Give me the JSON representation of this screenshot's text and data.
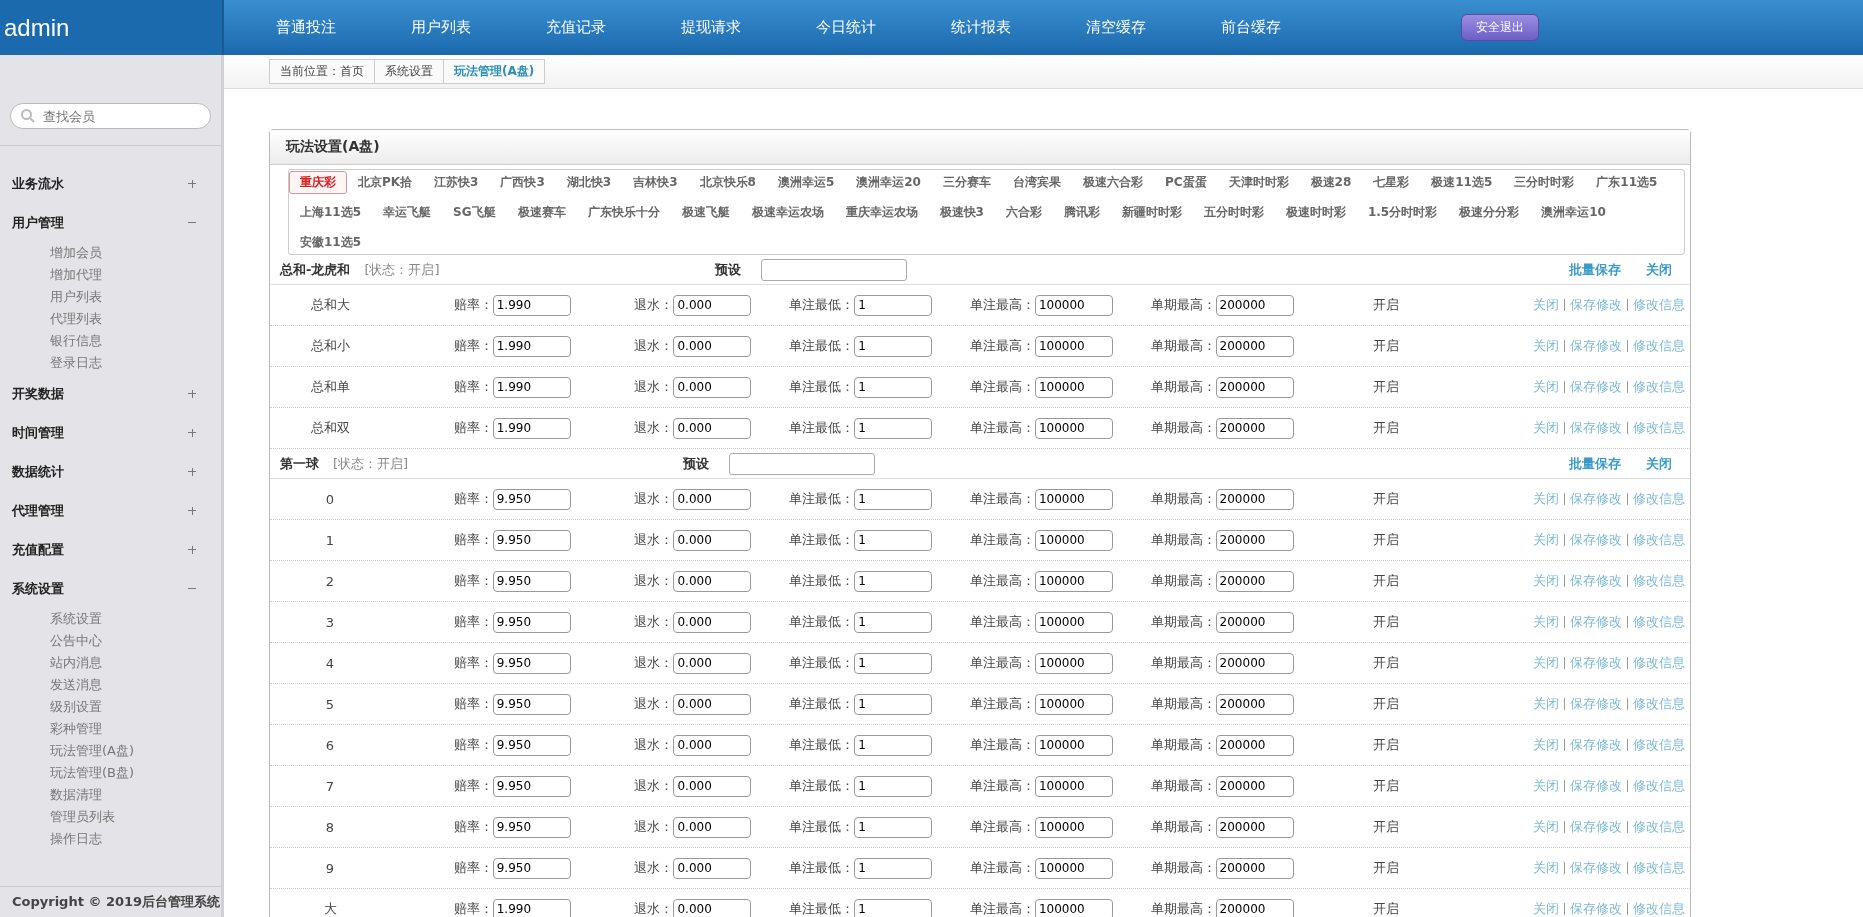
{
  "header": {
    "brand": "admin",
    "nav": [
      "普通投注",
      "用户列表",
      "充值记录",
      "提现请求",
      "今日统计",
      "统计报表",
      "清空缓存",
      "前台缓存"
    ],
    "logout": "安全退出"
  },
  "breadcrumb": [
    "当前位置：首页",
    "系统设置",
    "玩法管理(A盘)"
  ],
  "sidebar": {
    "search_placeholder": "查找会员",
    "menu": [
      {
        "label": "业务流水",
        "expanded": false
      },
      {
        "label": "用户管理",
        "expanded": true,
        "children": [
          "增加会员",
          "增加代理",
          "用户列表",
          "代理列表",
          "银行信息",
          "登录日志"
        ]
      },
      {
        "label": "开奖数据",
        "expanded": false
      },
      {
        "label": "时间管理",
        "expanded": false
      },
      {
        "label": "数据统计",
        "expanded": false
      },
      {
        "label": "代理管理",
        "expanded": false
      },
      {
        "label": "充值配置",
        "expanded": false
      },
      {
        "label": "系统设置",
        "expanded": true,
        "children": [
          "系统设置",
          "公告中心",
          "站内消息",
          "发送消息",
          "级别设置",
          "彩种管理",
          "玩法管理(A盘)",
          "玩法管理(B盘)",
          "数据清理",
          "管理员列表",
          "操作日志"
        ]
      }
    ],
    "copyright": "Copyright © 2019后台管理系统"
  },
  "panel": {
    "title": "玩法设置(A盘)",
    "lottery_tabs": [
      {
        "label": "重庆彩",
        "selected": true
      },
      {
        "label": "北京PK拾",
        "selected": false
      },
      {
        "label": "江苏快3",
        "selected": false
      },
      {
        "label": "广西快3",
        "selected": false
      },
      {
        "label": "湖北快3",
        "selected": false
      },
      {
        "label": "吉林快3",
        "selected": false
      },
      {
        "label": "北京快乐8",
        "selected": false
      },
      {
        "label": "澳洲幸运5",
        "selected": false
      },
      {
        "label": "澳洲幸运20",
        "selected": false
      },
      {
        "label": "三分赛车",
        "selected": false
      },
      {
        "label": "台湾宾果",
        "selected": false
      },
      {
        "label": "极速六合彩",
        "selected": false
      },
      {
        "label": "PC蛋蛋",
        "selected": false
      },
      {
        "label": "天津时时彩",
        "selected": false
      },
      {
        "label": "极速28",
        "selected": false
      },
      {
        "label": "七星彩",
        "selected": false
      },
      {
        "label": "极速11选5",
        "selected": false
      },
      {
        "label": "三分时时彩",
        "selected": false
      },
      {
        "label": "广东11选5",
        "selected": false
      },
      {
        "label": "上海11选5",
        "selected": false
      },
      {
        "label": "幸运飞艇",
        "selected": false
      },
      {
        "label": "SG飞艇",
        "selected": false
      },
      {
        "label": "极速赛车",
        "selected": false
      },
      {
        "label": "广东快乐十分",
        "selected": false
      },
      {
        "label": "极速飞艇",
        "selected": false
      },
      {
        "label": "极速幸运农场",
        "selected": false
      },
      {
        "label": "重庆幸运农场",
        "selected": false
      },
      {
        "label": "极速快3",
        "selected": false
      },
      {
        "label": "六合彩",
        "selected": false
      },
      {
        "label": "腾讯彩",
        "selected": false
      },
      {
        "label": "新疆时时彩",
        "selected": false
      },
      {
        "label": "五分时时彩",
        "selected": false
      },
      {
        "label": "极速时时彩",
        "selected": false
      },
      {
        "label": "1.5分时时彩",
        "selected": false
      },
      {
        "label": "极速分分彩",
        "selected": false
      },
      {
        "label": "澳洲幸运10",
        "selected": false
      },
      {
        "label": "安徽11选5",
        "selected": false
      }
    ],
    "groups": [
      {
        "name": "总和-龙虎和",
        "status": "[状态：开启]",
        "preset_label": "预设",
        "batch_save": "批量保存",
        "close": "关闭",
        "rows": [
          {
            "label": "总和大",
            "fields": [
              [
                "赔率：",
                "1.990"
              ],
              [
                "退水：",
                "0.000"
              ],
              [
                "单注最低：",
                "1"
              ],
              [
                "单注最高：",
                "100000"
              ],
              [
                "单期最高：",
                "200000"
              ]
            ],
            "state": "开启",
            "actions": [
              "关闭",
              "保存修改",
              "修改信息"
            ]
          },
          {
            "label": "总和小",
            "fields": [
              [
                "赔率：",
                "1.990"
              ],
              [
                "退水：",
                "0.000"
              ],
              [
                "单注最低：",
                "1"
              ],
              [
                "单注最高：",
                "100000"
              ],
              [
                "单期最高：",
                "200000"
              ]
            ],
            "state": "开启",
            "actions": [
              "关闭",
              "保存修改",
              "修改信息"
            ]
          },
          {
            "label": "总和单",
            "fields": [
              [
                "赔率：",
                "1.990"
              ],
              [
                "退水：",
                "0.000"
              ],
              [
                "单注最低：",
                "1"
              ],
              [
                "单注最高：",
                "100000"
              ],
              [
                "单期最高：",
                "200000"
              ]
            ],
            "state": "开启",
            "actions": [
              "关闭",
              "保存修改",
              "修改信息"
            ]
          },
          {
            "label": "总和双",
            "fields": [
              [
                "赔率：",
                "1.990"
              ],
              [
                "退水：",
                "0.000"
              ],
              [
                "单注最低：",
                "1"
              ],
              [
                "单注最高：",
                "100000"
              ],
              [
                "单期最高：",
                "200000"
              ]
            ],
            "state": "开启",
            "actions": [
              "关闭",
              "保存修改",
              "修改信息"
            ]
          }
        ]
      },
      {
        "name": "第一球",
        "status": "[状态：开启]",
        "preset_label": "预设",
        "batch_save": "批量保存",
        "close": "关闭",
        "rows": [
          {
            "label": "0",
            "fields": [
              [
                "赔率：",
                "9.950"
              ],
              [
                "退水：",
                "0.000"
              ],
              [
                "单注最低：",
                "1"
              ],
              [
                "单注最高：",
                "100000"
              ],
              [
                "单期最高：",
                "200000"
              ]
            ],
            "state": "开启",
            "actions": [
              "关闭",
              "保存修改",
              "修改信息"
            ]
          },
          {
            "label": "1",
            "fields": [
              [
                "赔率：",
                "9.950"
              ],
              [
                "退水：",
                "0.000"
              ],
              [
                "单注最低：",
                "1"
              ],
              [
                "单注最高：",
                "100000"
              ],
              [
                "单期最高：",
                "200000"
              ]
            ],
            "state": "开启",
            "actions": [
              "关闭",
              "保存修改",
              "修改信息"
            ]
          },
          {
            "label": "2",
            "fields": [
              [
                "赔率：",
                "9.950"
              ],
              [
                "退水：",
                "0.000"
              ],
              [
                "单注最低：",
                "1"
              ],
              [
                "单注最高：",
                "100000"
              ],
              [
                "单期最高：",
                "200000"
              ]
            ],
            "state": "开启",
            "actions": [
              "关闭",
              "保存修改",
              "修改信息"
            ]
          },
          {
            "label": "3",
            "fields": [
              [
                "赔率：",
                "9.950"
              ],
              [
                "退水：",
                "0.000"
              ],
              [
                "单注最低：",
                "1"
              ],
              [
                "单注最高：",
                "100000"
              ],
              [
                "单期最高：",
                "200000"
              ]
            ],
            "state": "开启",
            "actions": [
              "关闭",
              "保存修改",
              "修改信息"
            ]
          },
          {
            "label": "4",
            "fields": [
              [
                "赔率：",
                "9.950"
              ],
              [
                "退水：",
                "0.000"
              ],
              [
                "单注最低：",
                "1"
              ],
              [
                "单注最高：",
                "100000"
              ],
              [
                "单期最高：",
                "200000"
              ]
            ],
            "state": "开启",
            "actions": [
              "关闭",
              "保存修改",
              "修改信息"
            ]
          },
          {
            "label": "5",
            "fields": [
              [
                "赔率：",
                "9.950"
              ],
              [
                "退水：",
                "0.000"
              ],
              [
                "单注最低：",
                "1"
              ],
              [
                "单注最高：",
                "100000"
              ],
              [
                "单期最高：",
                "200000"
              ]
            ],
            "state": "开启",
            "actions": [
              "关闭",
              "保存修改",
              "修改信息"
            ]
          },
          {
            "label": "6",
            "fields": [
              [
                "赔率：",
                "9.950"
              ],
              [
                "退水：",
                "0.000"
              ],
              [
                "单注最低：",
                "1"
              ],
              [
                "单注最高：",
                "100000"
              ],
              [
                "单期最高：",
                "200000"
              ]
            ],
            "state": "开启",
            "actions": [
              "关闭",
              "保存修改",
              "修改信息"
            ]
          },
          {
            "label": "7",
            "fields": [
              [
                "赔率：",
                "9.950"
              ],
              [
                "退水：",
                "0.000"
              ],
              [
                "单注最低：",
                "1"
              ],
              [
                "单注最高：",
                "100000"
              ],
              [
                "单期最高：",
                "200000"
              ]
            ],
            "state": "开启",
            "actions": [
              "关闭",
              "保存修改",
              "修改信息"
            ]
          },
          {
            "label": "8",
            "fields": [
              [
                "赔率：",
                "9.950"
              ],
              [
                "退水：",
                "0.000"
              ],
              [
                "单注最低：",
                "1"
              ],
              [
                "单注最高：",
                "100000"
              ],
              [
                "单期最高：",
                "200000"
              ]
            ],
            "state": "开启",
            "actions": [
              "关闭",
              "保存修改",
              "修改信息"
            ]
          },
          {
            "label": "9",
            "fields": [
              [
                "赔率：",
                "9.950"
              ],
              [
                "退水：",
                "0.000"
              ],
              [
                "单注最低：",
                "1"
              ],
              [
                "单注最高：",
                "100000"
              ],
              [
                "单期最高：",
                "200000"
              ]
            ],
            "state": "开启",
            "actions": [
              "关闭",
              "保存修改",
              "修改信息"
            ]
          },
          {
            "label": "大",
            "fields": [
              [
                "赔率：",
                "1.990"
              ],
              [
                "退水：",
                "0.000"
              ],
              [
                "单注最低：",
                "1"
              ],
              [
                "单注最高：",
                "100000"
              ],
              [
                "单期最高：",
                "200000"
              ]
            ],
            "state": "开启",
            "actions": [
              "关闭",
              "保存修改",
              "修改信息"
            ]
          }
        ]
      }
    ]
  }
}
